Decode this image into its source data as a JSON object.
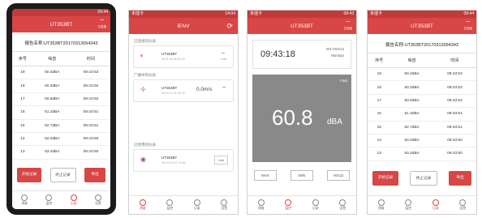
{
  "colors": {
    "accent": "#d84646",
    "meter_bg": "#898989"
  },
  "phone1": {
    "status_left": "",
    "status_right": "09:44",
    "title": "UT353BT",
    "wifi_label": "已连接",
    "report": "报告名称:UT353BT20170313094343",
    "columns": [
      "序号",
      "噪音",
      "时间"
    ],
    "rows": [
      [
        "19",
        "50.3dBA",
        "09:43:53"
      ],
      [
        "18",
        "50.3dBA",
        "09:43:52"
      ],
      [
        "17",
        "50.6dBA",
        "09:43:52"
      ],
      [
        "16",
        "51.3dBA",
        "09:43:51"
      ],
      [
        "15",
        "52.7dBA",
        "09:43:51"
      ],
      [
        "14",
        "52.0dBA",
        "09:43:50"
      ],
      [
        "13",
        "53.4dBA",
        "09:43:50"
      ]
    ],
    "btn_start": "开始记录",
    "btn_stop": "终止记录",
    "btn_export": "导出",
    "tabs": [
      "测量",
      "监控",
      "记录",
      "设置"
    ]
  },
  "phone2": {
    "status_left": "未插卡",
    "status_right": "14:04",
    "title": "iENV",
    "section_connected": "已连接的仪表:",
    "device1": {
      "name": "UT353BT",
      "id": "08:91:86:45:0D:40",
      "signal": "-71dB"
    },
    "section_broadcast": "广播中的仪表:",
    "device2": {
      "name": "UT363BT",
      "id": "0D:91:11:91:4E:40",
      "value": "0.0m/s"
    },
    "section_unconnected": "已停用的仪表:",
    "device3": {
      "name": "UT383BT",
      "id": "0D:91:4E:12:71:0B",
      "button": "Link"
    },
    "tabs": [
      "测量",
      "监控",
      "记录",
      "设置"
    ]
  },
  "phone3": {
    "status_left": "未插卡",
    "status_right": "09:43",
    "title": "UT353BT",
    "wifi_label": "已连接",
    "time": "09:43:18",
    "date": "2017/03/13",
    "weekday": "Monday",
    "mode": "Fast",
    "reading": "60.8",
    "unit": "dBA",
    "buttons": [
      "MAX",
      "MIN",
      "HOLD"
    ],
    "tabs": [
      "测量",
      "监控",
      "记录",
      "设置"
    ]
  },
  "phone4": {
    "status_left": "未插卡",
    "status_right": "09:44",
    "title": "UT353BT",
    "wifi_label": "已连接",
    "report": "报告名称:UT353BT20170313094343",
    "columns": [
      "序号",
      "噪音",
      "时间"
    ],
    "rows": [
      [
        "19",
        "50.3dBA",
        "09:43:53"
      ],
      [
        "18",
        "50.3dBA",
        "09:43:52"
      ],
      [
        "17",
        "50.6dBA",
        "09:43:52"
      ],
      [
        "16",
        "51.3dBA",
        "09:43:51"
      ],
      [
        "15",
        "52.7dBA",
        "09:43:51"
      ],
      [
        "14",
        "52.0dBA",
        "09:43:50"
      ],
      [
        "13",
        "53.4dBA",
        "09:43:50"
      ]
    ],
    "btn_start": "开始记录",
    "btn_stop": "终止记录",
    "btn_export": "导出",
    "tabs": [
      "测量",
      "监控",
      "记录",
      "设置"
    ]
  }
}
